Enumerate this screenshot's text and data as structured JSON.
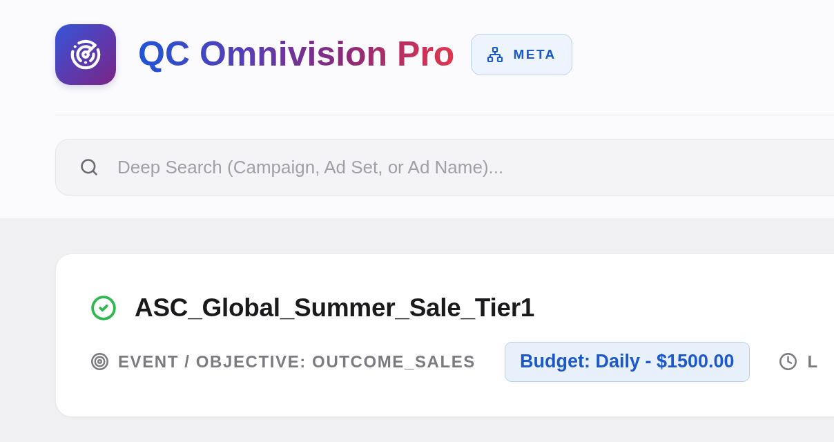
{
  "app": {
    "title": "QC Omnivision Pro",
    "platform_badge": "META"
  },
  "search": {
    "placeholder": "Deep Search (Campaign, Ad Set, or Ad Name)..."
  },
  "campaign": {
    "name": "ASC_Global_Summer_Sale_Tier1",
    "active": true,
    "objective": "EVENT / OBJECTIVE: OUTCOME_SALES",
    "budget": "Budget: Daily - $1500.00",
    "meta_3": "L"
  }
}
